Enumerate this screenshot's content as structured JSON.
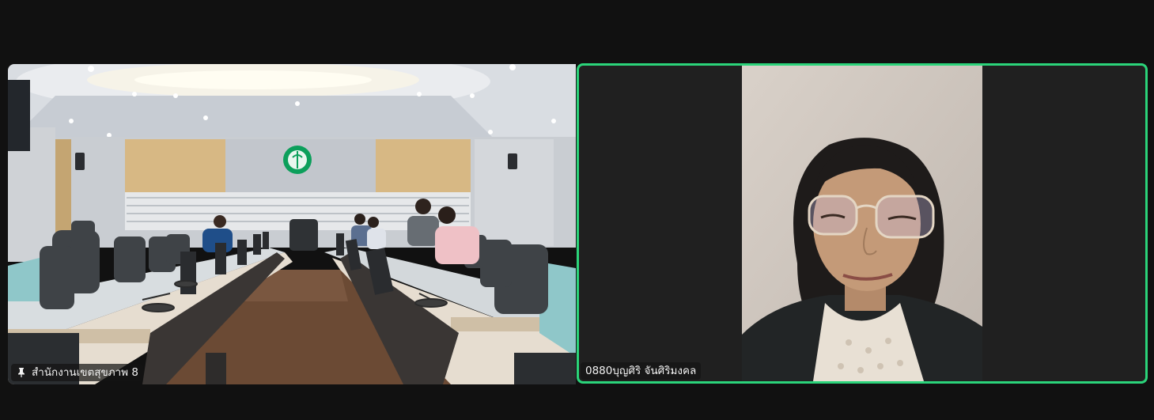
{
  "participants": [
    {
      "name": "สำนักงานเขตสุขภาพ 8",
      "pinned": true,
      "icon": "pin-icon"
    },
    {
      "name": "0880บุญศิริ จันศิริมงคล",
      "active_speaker": true
    }
  ],
  "room_sign": "สำนักงานเขตสุขภาพที่ 8",
  "colors": {
    "background": "#111111",
    "active_speaker_border": "#2bd47a",
    "label_bg": "rgba(20,20,20,0.72)"
  }
}
